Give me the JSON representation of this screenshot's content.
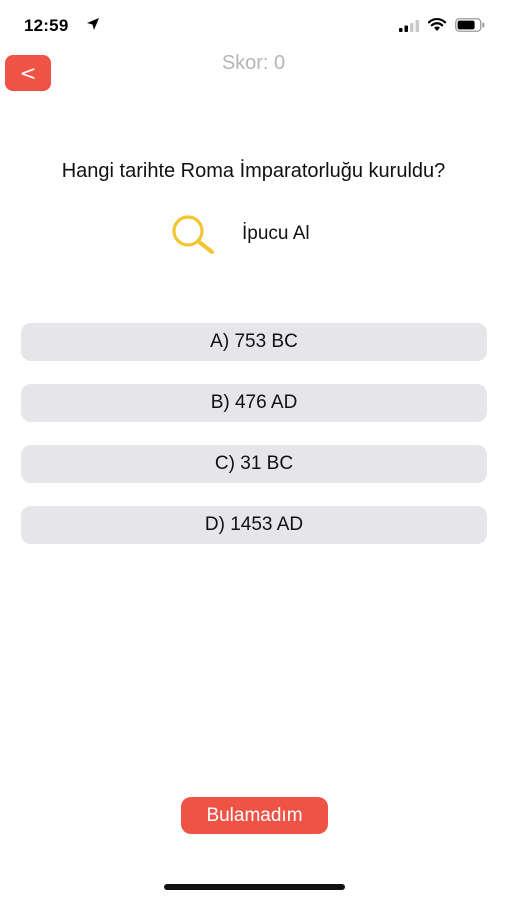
{
  "status_bar": {
    "time": "12:59",
    "icons": [
      "location-arrow-icon",
      "signal-icon",
      "wifi-icon",
      "battery-icon"
    ]
  },
  "header": {
    "back_label": "<",
    "score_text": "Skor: 0"
  },
  "question": {
    "text": "Hangi tarihte Roma İmparatorluğu kuruldu?"
  },
  "hint": {
    "icon": "magnifier-icon",
    "label": "İpucu Al"
  },
  "options": [
    {
      "label": "A) 753 BC"
    },
    {
      "label": "B) 476 AD"
    },
    {
      "label": "C) 31 BC"
    },
    {
      "label": "D) 1453 AD"
    }
  ],
  "footer": {
    "give_up_label": "Bulamadım"
  },
  "colors": {
    "accent": "#ef5346",
    "option_bg": "#e6e6ea",
    "hint_icon": "#f2c531",
    "score_text": "#b5b5b5"
  }
}
